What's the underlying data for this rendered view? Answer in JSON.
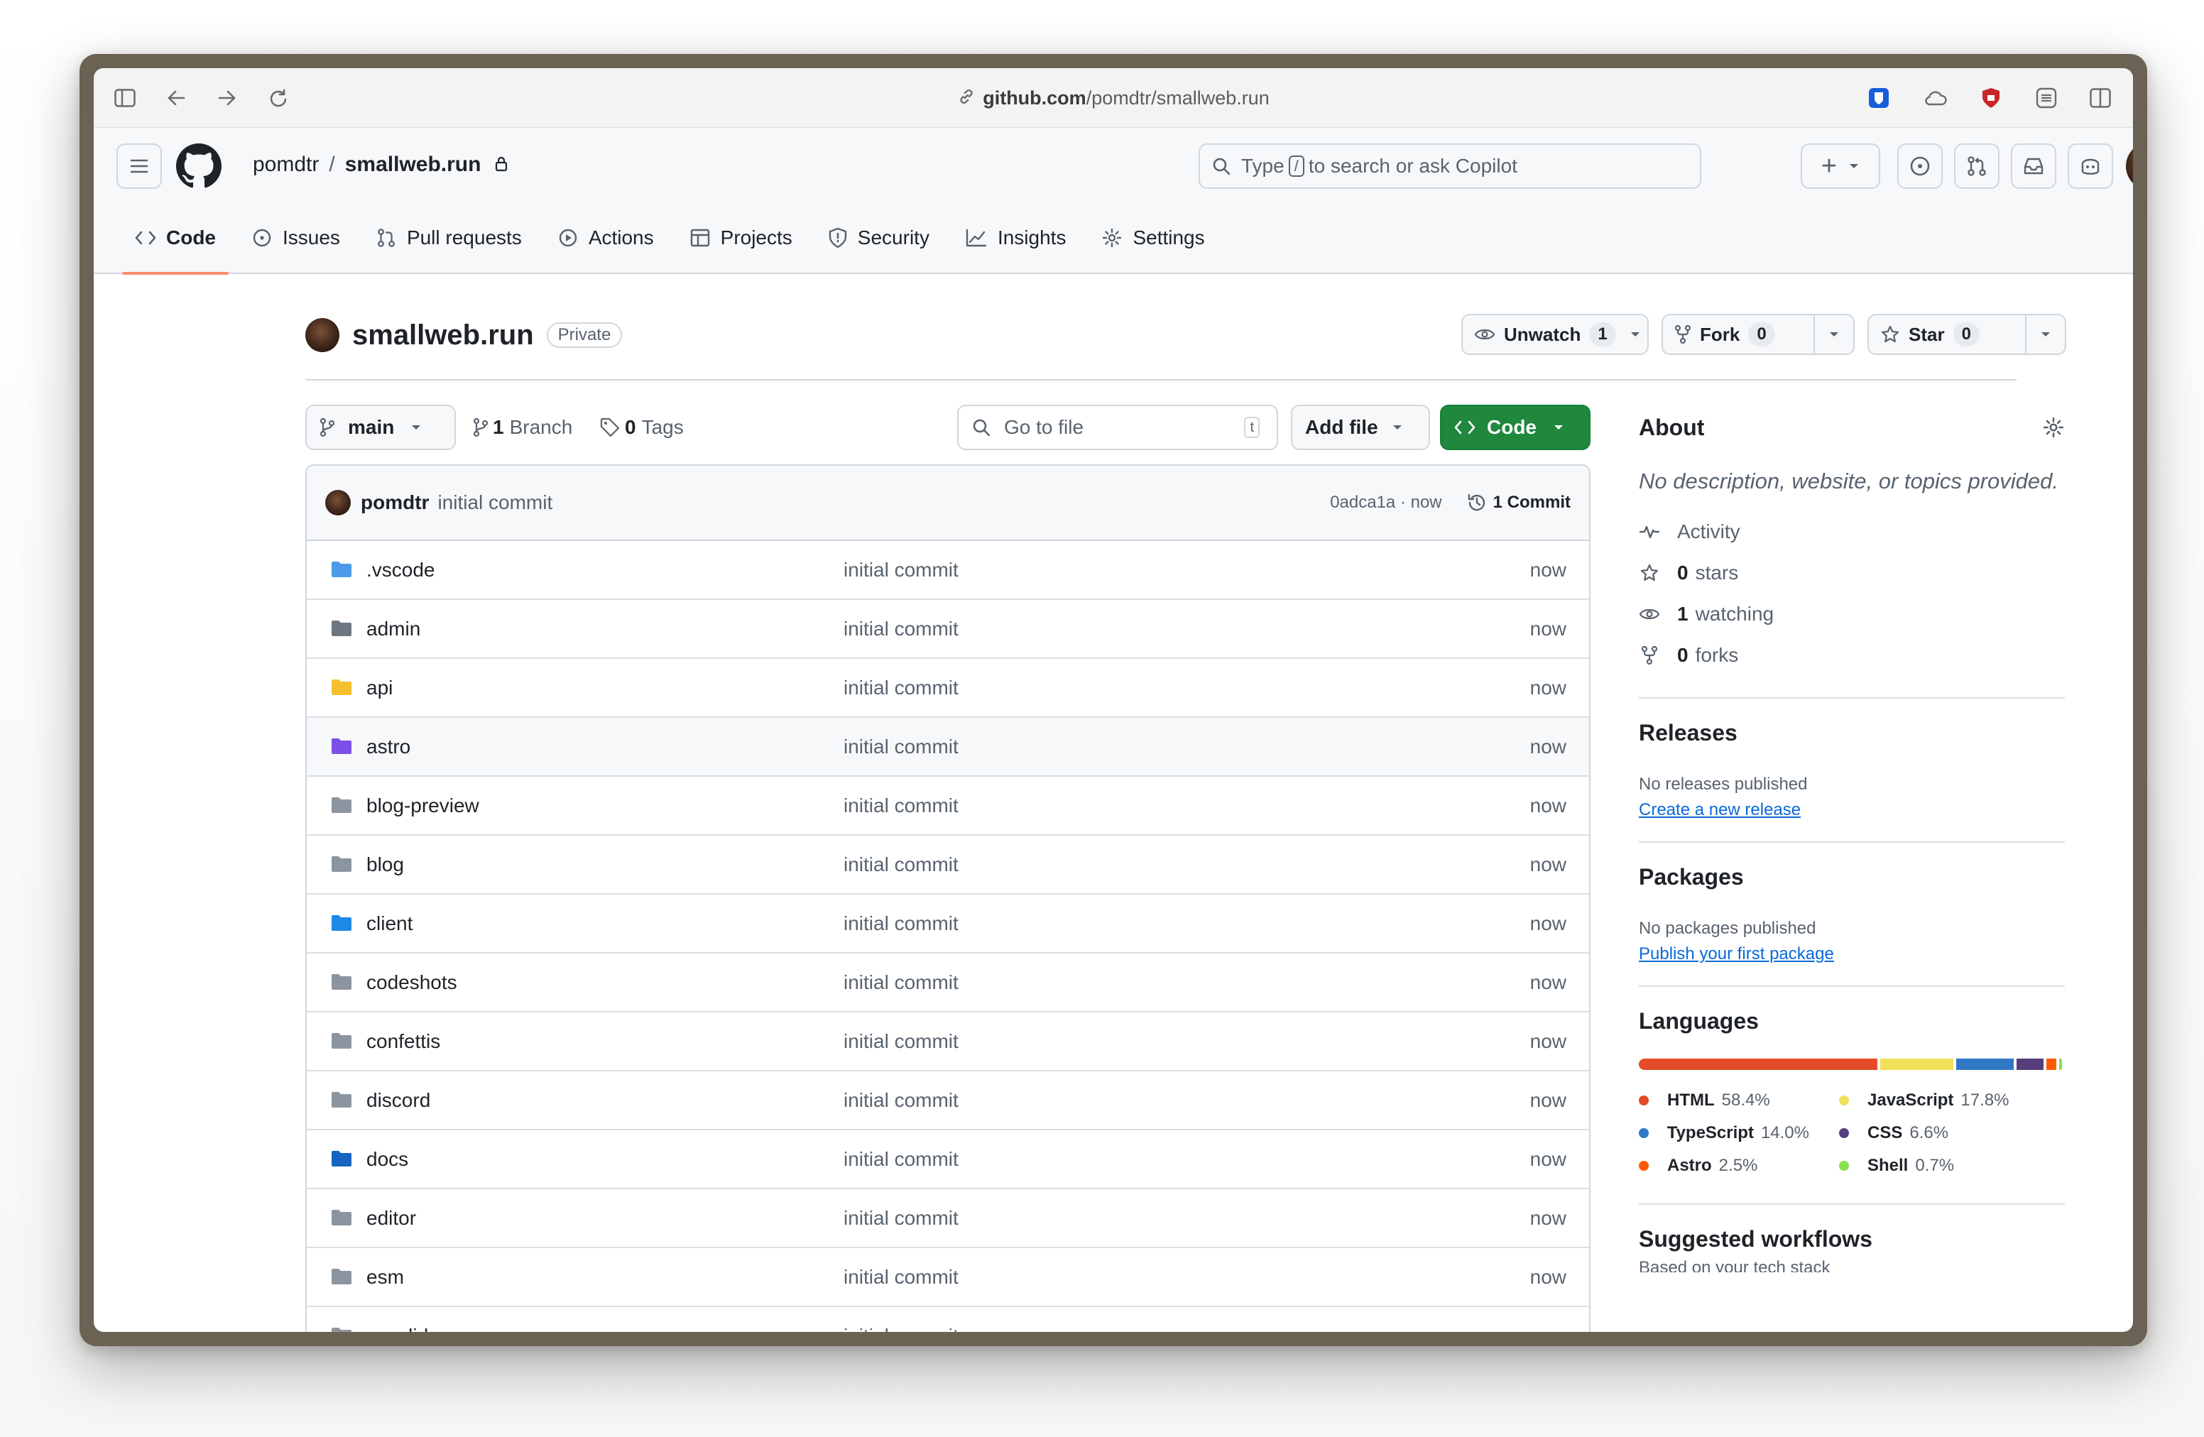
{
  "browser": {
    "url_host": "github.com",
    "url_path": "/pomdtr/smallweb.run"
  },
  "header": {
    "owner": "pomdtr",
    "separator": "/",
    "repo": "smallweb.run",
    "search_placeholder_before": "Type",
    "search_key": "/",
    "search_placeholder_after": "to search or ask Copilot",
    "new_button": "+"
  },
  "tabs": [
    {
      "label": "Code",
      "icon": "code-icon",
      "active": true
    },
    {
      "label": "Issues",
      "icon": "issue-icon"
    },
    {
      "label": "Pull requests",
      "icon": "pull-request-icon"
    },
    {
      "label": "Actions",
      "icon": "play-icon"
    },
    {
      "label": "Projects",
      "icon": "table-icon"
    },
    {
      "label": "Security",
      "icon": "shield-icon"
    },
    {
      "label": "Insights",
      "icon": "graph-icon"
    },
    {
      "label": "Settings",
      "icon": "gear-icon"
    }
  ],
  "repo": {
    "name": "smallweb.run",
    "visibility": "Private",
    "unwatch_label": "Unwatch",
    "watch_count": "1",
    "fork_label": "Fork",
    "fork_count": "0",
    "star_label": "Star",
    "star_count": "0"
  },
  "toolbar": {
    "branch": "main",
    "branches_count": "1",
    "branches_label": "Branch",
    "tags_count": "0",
    "tags_label": "Tags",
    "go_to_file": "Go to file",
    "go_to_file_key": "t",
    "add_file": "Add file",
    "code": "Code"
  },
  "latest_commit": {
    "author": "pomdtr",
    "message": "initial commit",
    "sha_time": "0adca1a · now",
    "commits": "1 Commit"
  },
  "files": [
    {
      "name": ".vscode",
      "message": "initial commit",
      "age": "now",
      "color": "#4d9be8"
    },
    {
      "name": "admin",
      "message": "initial commit",
      "age": "now",
      "color": "#6e7781"
    },
    {
      "name": "api",
      "message": "initial commit",
      "age": "now",
      "color": "#f5c02d"
    },
    {
      "name": "astro",
      "message": "initial commit",
      "age": "now",
      "color": "#7e4ee8"
    },
    {
      "name": "blog-preview",
      "message": "initial commit",
      "age": "now",
      "color": "#8c959f"
    },
    {
      "name": "blog",
      "message": "initial commit",
      "age": "now",
      "color": "#8c959f"
    },
    {
      "name": "client",
      "message": "initial commit",
      "age": "now",
      "color": "#1e88e5"
    },
    {
      "name": "codeshots",
      "message": "initial commit",
      "age": "now",
      "color": "#8c959f"
    },
    {
      "name": "confettis",
      "message": "initial commit",
      "age": "now",
      "color": "#8c959f"
    },
    {
      "name": "discord",
      "message": "initial commit",
      "age": "now",
      "color": "#8c959f"
    },
    {
      "name": "docs",
      "message": "initial commit",
      "age": "now",
      "color": "#1565c0"
    },
    {
      "name": "editor",
      "message": "initial commit",
      "age": "now",
      "color": "#8c959f"
    },
    {
      "name": "esm",
      "message": "initial commit",
      "age": "now",
      "color": "#8c959f"
    },
    {
      "name": "excalidraw",
      "message": "initial commit",
      "age": "now",
      "color": "#8c959f"
    }
  ],
  "about": {
    "title": "About",
    "description": "No description, website, or topics provided.",
    "activity": "Activity",
    "stars_count": "0",
    "stars_label": "stars",
    "watching_count": "1",
    "watching_label": "watching",
    "forks_count": "0",
    "forks_label": "forks"
  },
  "releases": {
    "title": "Releases",
    "empty": "No releases published",
    "link": "Create a new release"
  },
  "packages": {
    "title": "Packages",
    "empty": "No packages published",
    "link": "Publish your first package"
  },
  "languages": {
    "title": "Languages",
    "items": [
      {
        "name": "HTML",
        "percent": "58.4%",
        "value": 58.4,
        "color": "#e34c26"
      },
      {
        "name": "JavaScript",
        "percent": "17.8%",
        "value": 17.8,
        "color": "#f1e05a"
      },
      {
        "name": "TypeScript",
        "percent": "14.0%",
        "value": 14.0,
        "color": "#3178c6"
      },
      {
        "name": "CSS",
        "percent": "6.6%",
        "value": 6.6,
        "color": "#563d7c"
      },
      {
        "name": "Astro",
        "percent": "2.5%",
        "value": 2.5,
        "color": "#ff5a03"
      },
      {
        "name": "Shell",
        "percent": "0.7%",
        "value": 0.7,
        "color": "#89e051"
      }
    ]
  },
  "suggested": {
    "title": "Suggested workflows",
    "subtitle": "Based on your tech stack"
  },
  "colors": {
    "accent_green": "#1f883d",
    "link_blue": "#0969da",
    "active_tab_underline": "#fd8c73"
  }
}
